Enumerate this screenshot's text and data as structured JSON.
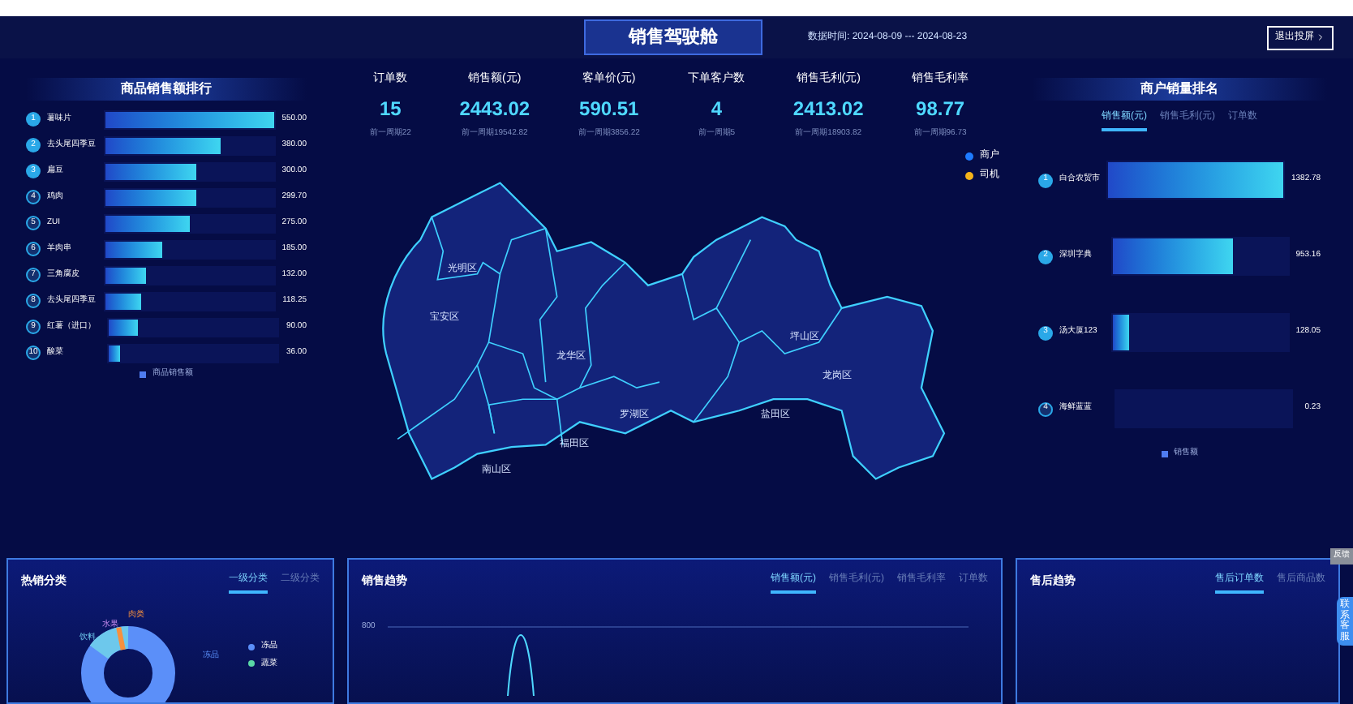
{
  "header": {
    "title": "销售驾驶舱",
    "date_range": "数据时间: 2024-08-09 --- 2024-08-23",
    "exit_button": "退出投屏"
  },
  "product_ranking": {
    "title": "商品销售额排行",
    "legend": "商品销售额",
    "items": [
      {
        "rank": "1",
        "name": "薯味片",
        "value": "550.00",
        "level": 1
      },
      {
        "rank": "2",
        "name": "去头尾四季豆",
        "value": "380.00",
        "level": 0.69
      },
      {
        "rank": "3",
        "name": "扁豆",
        "value": "300.00",
        "level": 0.545
      },
      {
        "rank": "4",
        "name": "鸡肉",
        "value": "299.70",
        "level": 0.545
      },
      {
        "rank": "5",
        "name": "ZUI",
        "value": "275.00",
        "level": 0.5
      },
      {
        "rank": "6",
        "name": "羊肉串",
        "value": "185.00",
        "level": 0.336
      },
      {
        "rank": "7",
        "name": "三角腐皮",
        "value": "132.00",
        "level": 0.24
      },
      {
        "rank": "8",
        "name": "去头尾四季豆",
        "value": "118.25",
        "level": 0.215
      },
      {
        "rank": "9",
        "name": "红薯（进口）",
        "value": "90.00",
        "level": 0.164
      },
      {
        "rank": "10",
        "name": "酸菜",
        "value": "36.00",
        "level": 0.065
      }
    ]
  },
  "kpis": [
    {
      "label": "订单数",
      "value": "15",
      "previous": "前一周期22"
    },
    {
      "label": "销售额(元)",
      "value": "2443.02",
      "previous": "前一周期19542.82"
    },
    {
      "label": "客单价(元)",
      "value": "590.51",
      "previous": "前一周期3856.22"
    },
    {
      "label": "下单客户数",
      "value": "4",
      "previous": "前一周期5"
    },
    {
      "label": "销售毛利(元)",
      "value": "2413.02",
      "previous": "前一周期18903.82"
    },
    {
      "label": "销售毛利率",
      "value": "98.77",
      "previous": "前一周期96.73"
    }
  ],
  "map": {
    "legend": [
      {
        "label": "商户",
        "color": "#1e7bff"
      },
      {
        "label": "司机",
        "color": "#f5b31a"
      }
    ],
    "districts": [
      "光明区",
      "宝安区",
      "龙华区",
      "坪山区",
      "龙岗区",
      "盐田区",
      "罗湖区",
      "福田区",
      "南山区"
    ]
  },
  "merchant_ranking": {
    "title": "商户销量排名",
    "legend": "销售额",
    "tabs": [
      {
        "label": "销售额(元)",
        "selected": true
      },
      {
        "label": "销售毛利(元)",
        "selected": false
      },
      {
        "label": "订单数",
        "selected": false
      }
    ],
    "items": [
      {
        "rank": "1",
        "name": "白合农贸市",
        "value": "1382.78",
        "level": 1
      },
      {
        "rank": "2",
        "name": "深圳字典",
        "value": "953.16",
        "level": 0.69
      },
      {
        "rank": "3",
        "name": "汤大厦123",
        "value": "128.05",
        "level": 0.093
      },
      {
        "rank": "4",
        "name": "海鲜蓝蓝",
        "value": "0.23",
        "level": 0
      }
    ]
  },
  "hot_categories": {
    "title": "热销分类",
    "tabs": [
      {
        "label": "一级分类",
        "selected": true
      },
      {
        "label": "二级分类",
        "selected": false
      }
    ],
    "pie_labels": [
      "水果",
      "肉类",
      "饮料",
      "冻品"
    ],
    "legend": [
      {
        "label": "冻品",
        "color": "#5b8ff9"
      },
      {
        "label": "蔬菜",
        "color": "#5ad8a6"
      }
    ]
  },
  "sales_trend": {
    "title": "销售趋势",
    "tabs": [
      {
        "label": "销售额(元)",
        "selected": true
      },
      {
        "label": "销售毛利(元)",
        "selected": false
      },
      {
        "label": "销售毛利率",
        "selected": false
      },
      {
        "label": "订单数",
        "selected": false
      }
    ],
    "y_tick": "800"
  },
  "after_sales": {
    "title": "售后趋势",
    "tabs": [
      {
        "label": "售后订单数",
        "selected": true
      },
      {
        "label": "售后商品数",
        "selected": false
      }
    ]
  },
  "side_widgets": {
    "feedback": "反馈",
    "service": "联系客服"
  }
}
